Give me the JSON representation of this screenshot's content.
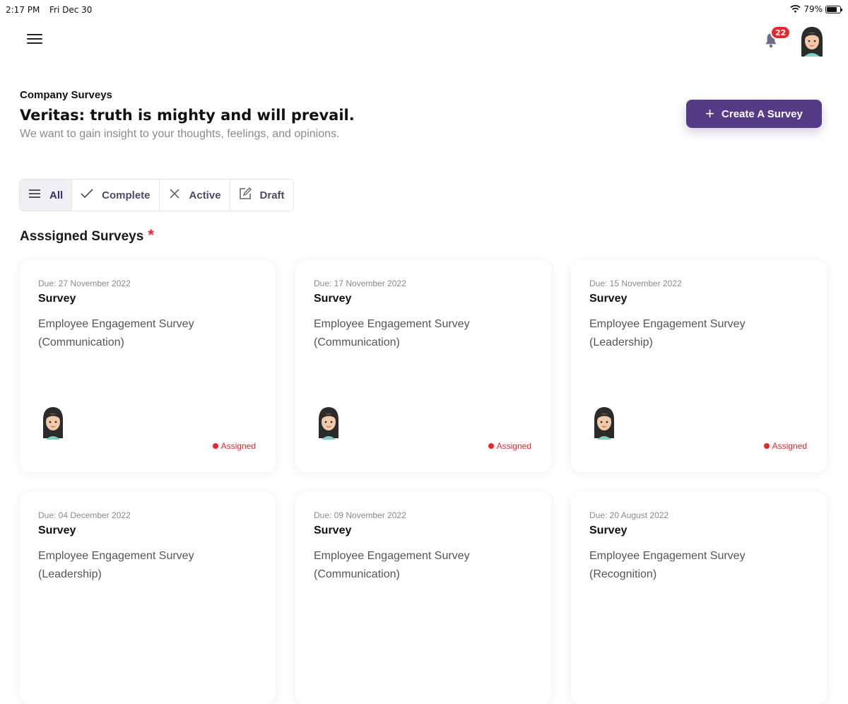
{
  "status_bar": {
    "time": "2:17 PM",
    "date": "Fri Dec 30",
    "battery": "79%",
    "battery_level": 0.79
  },
  "header": {
    "notification_count": "22"
  },
  "page": {
    "kicker": "Company Surveys",
    "title": "Veritas: truth is mighty and will prevail.",
    "subtitle": "We want to gain insight to your thoughts, feelings, and opinions.",
    "create_button": "Create A Survey"
  },
  "filters": [
    {
      "label": "All",
      "icon": "menu-icon",
      "active": true
    },
    {
      "label": "Complete",
      "icon": "check-icon",
      "active": false
    },
    {
      "label": "Active",
      "icon": "x-icon",
      "active": false
    },
    {
      "label": "Draft",
      "icon": "edit-icon",
      "active": false
    }
  ],
  "section": {
    "title": "Asssigned Surveys",
    "required_mark": "*"
  },
  "cards": [
    {
      "due": "Due: 27 November 2022",
      "type": "Survey",
      "name": "Employee Engagement Survey (Communication)",
      "status": "Assigned"
    },
    {
      "due": "Due: 17 November 2022",
      "type": "Survey",
      "name": "Employee Engagement Survey (Communication)",
      "status": "Assigned"
    },
    {
      "due": "Due: 15 November 2022",
      "type": "Survey",
      "name": "Employee Engagement Survey (Leadership)",
      "status": "Assigned"
    },
    {
      "due": "Due: 04 December 2022",
      "type": "Survey",
      "name": "Employee Engagement Survey (Leadership)",
      "status": ""
    },
    {
      "due": "Due: 09 November 2022",
      "type": "Survey",
      "name": "Employee Engagement Survey (Communication)",
      "status": ""
    },
    {
      "due": "Due: 20 August 2022",
      "type": "Survey",
      "name": "Employee Engagement Survey (Recognition)",
      "status": ""
    }
  ],
  "colors": {
    "accent": "#553a86",
    "status_red": "#e8262d"
  }
}
